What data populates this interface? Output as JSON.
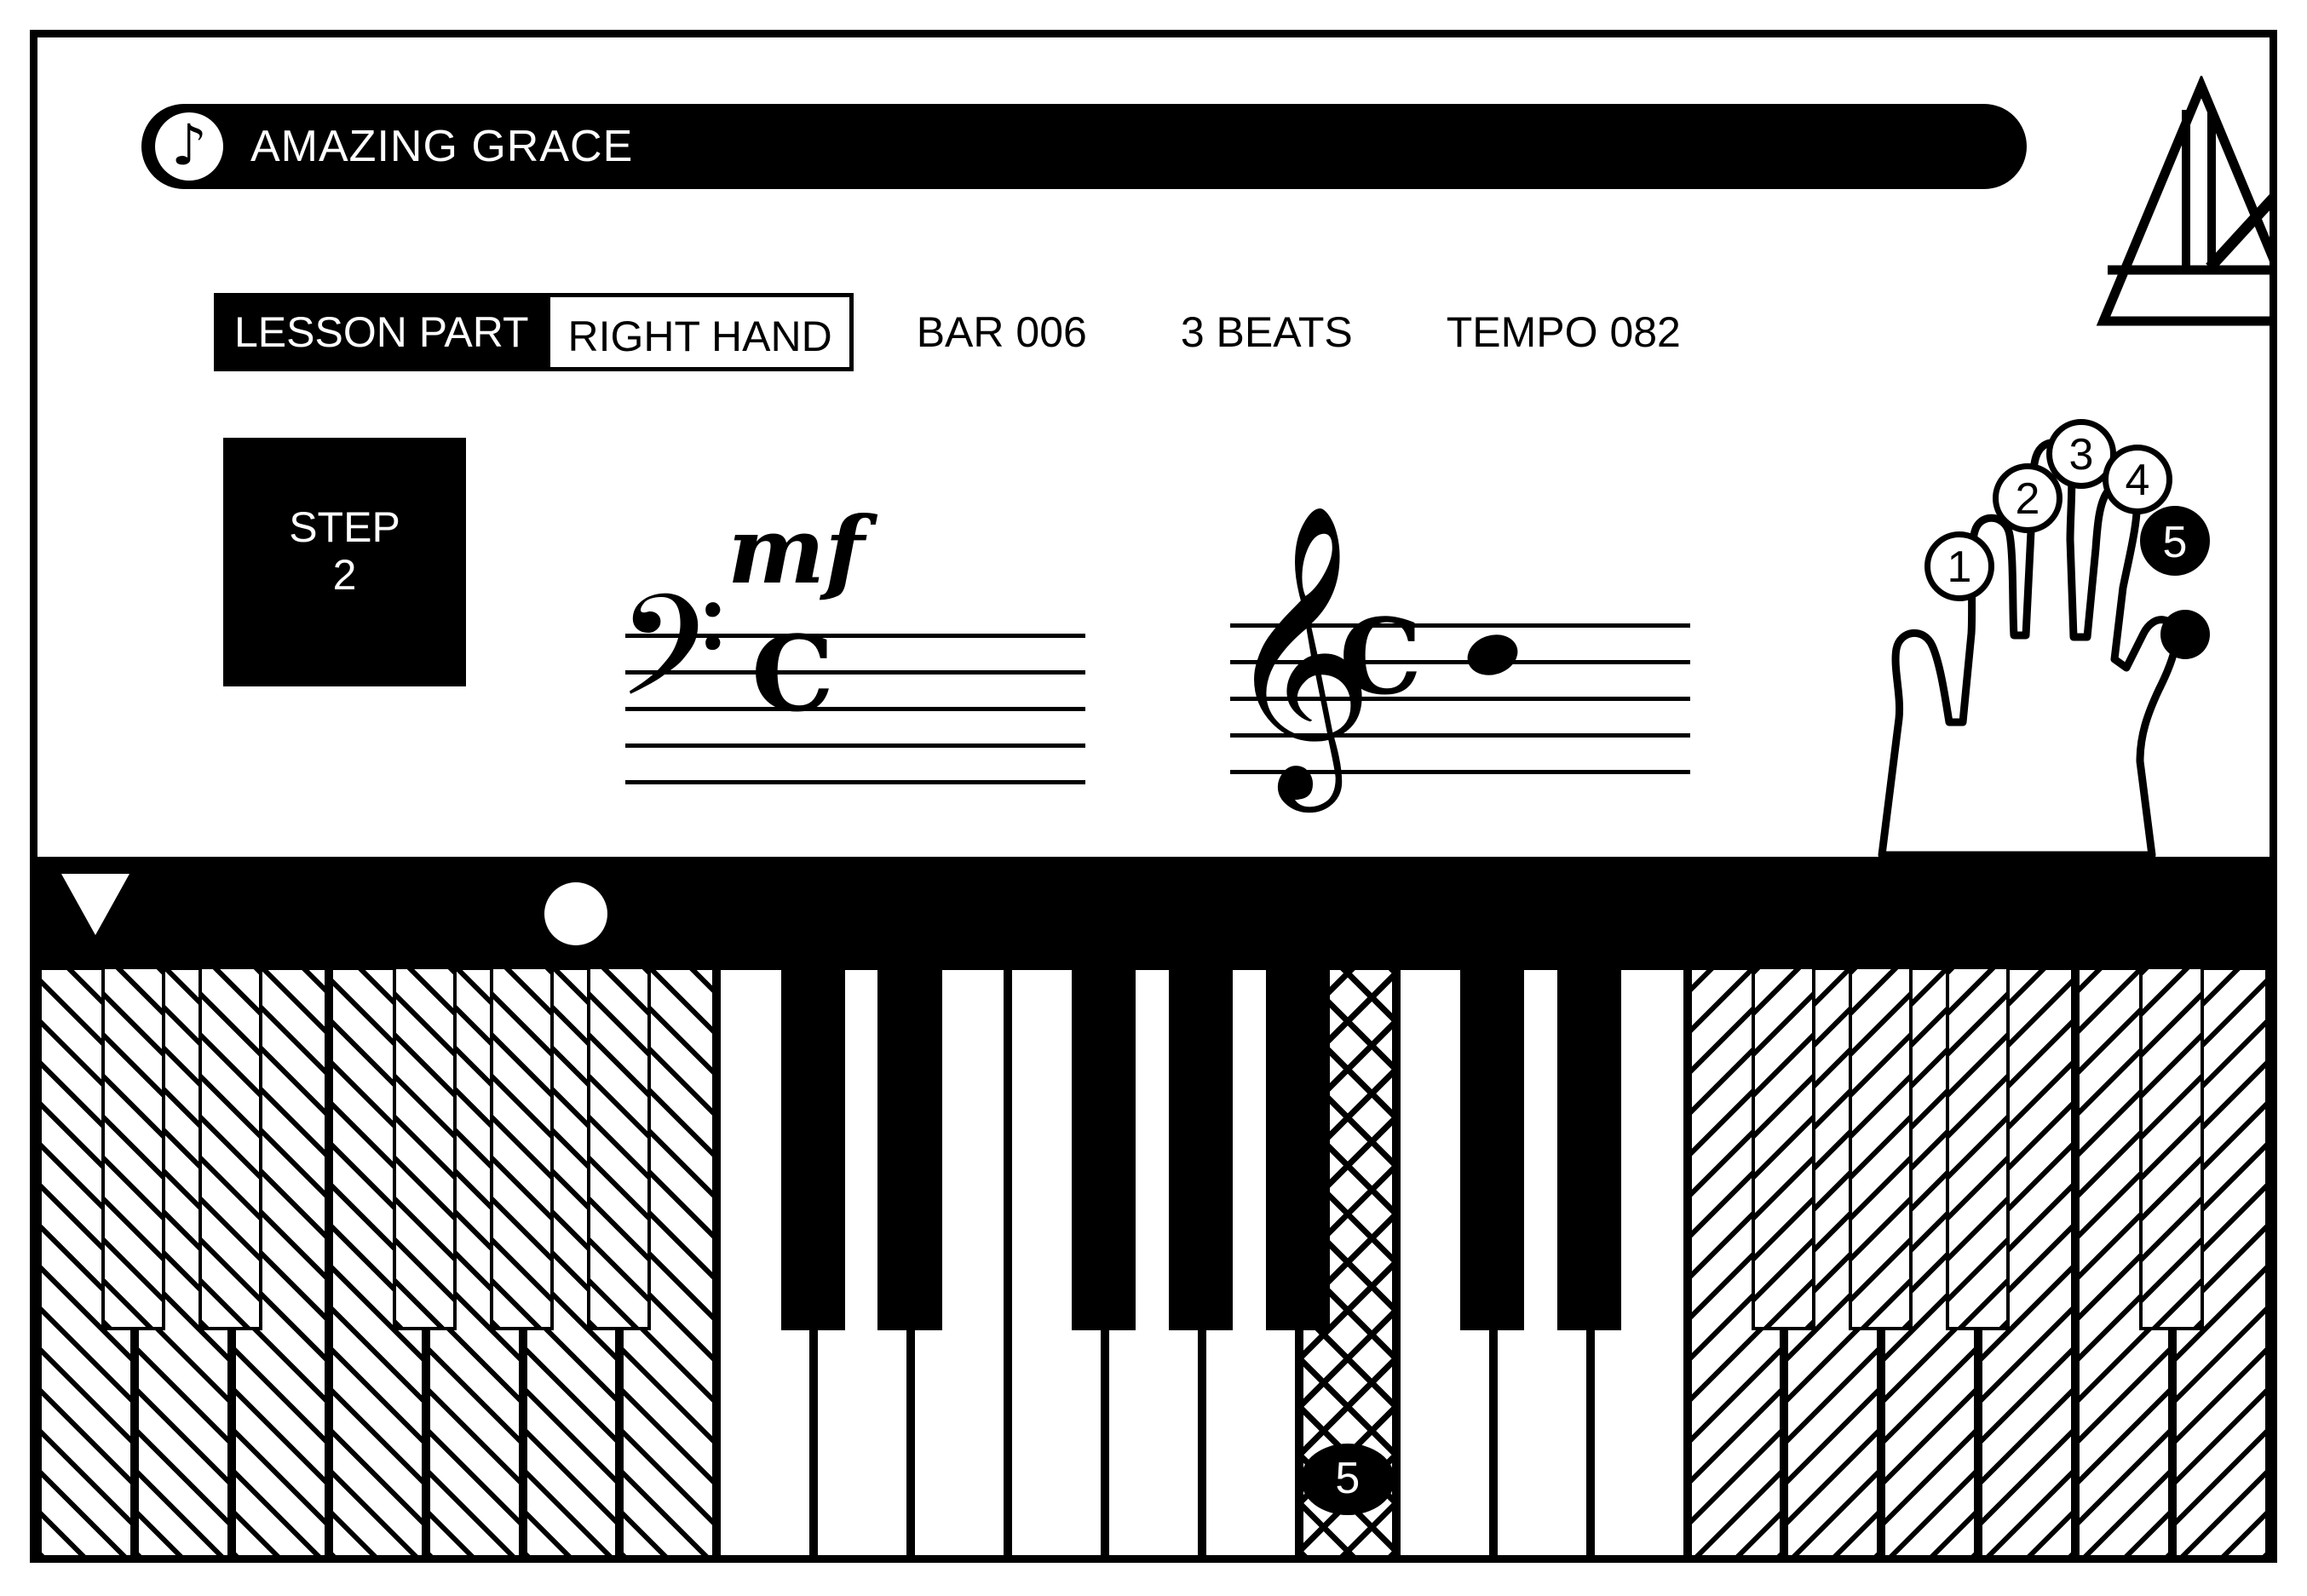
{
  "app": {
    "title": "AMAZING GRACE",
    "title_icon": "eighth-note-icon"
  },
  "status": {
    "lesson_part_label": "LESSON PART",
    "hand_value": "RIGHT HAND",
    "bar": "BAR 006",
    "beats": "3 BEATS",
    "tempo": "TEMPO 082"
  },
  "step": {
    "label": "STEP",
    "value": "2"
  },
  "score": {
    "dynamic": "mf",
    "bass_clef_glyph": "𝄢",
    "bass_time_signature": "C",
    "treble_clef_glyph": "𝄞",
    "treble_time_signature": "C"
  },
  "hand": {
    "fingers": [
      {
        "number": "1",
        "active": false
      },
      {
        "number": "2",
        "active": false
      },
      {
        "number": "3",
        "active": false
      },
      {
        "number": "4",
        "active": false
      },
      {
        "number": "5",
        "active": true
      }
    ]
  },
  "keyboard": {
    "cursor_marker": "playhead-triangle",
    "note_marker": "active-note-dot",
    "highlighted_key_finger": "5",
    "active_range_start": 7,
    "active_range_end": 16
  }
}
